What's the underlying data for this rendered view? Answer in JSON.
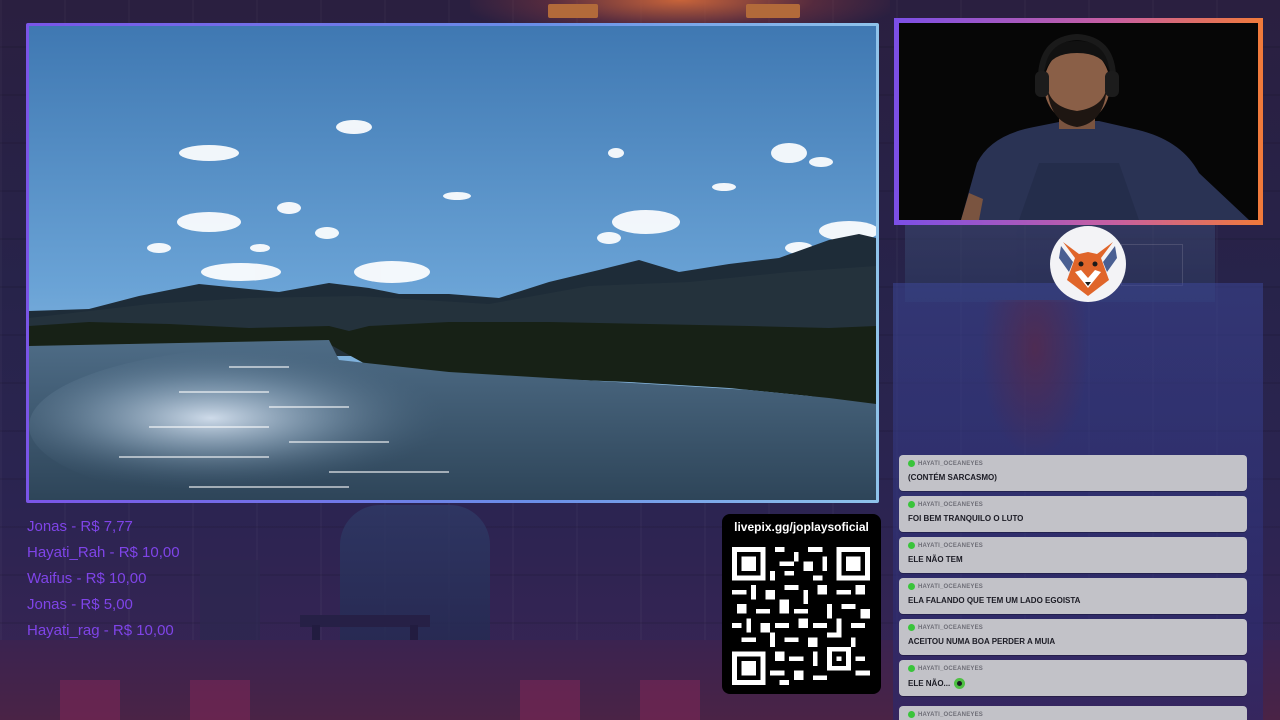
{
  "donations": [
    {
      "label": "Jonas - R$ 7,77"
    },
    {
      "label": "Hayati_Rah - R$ 10,00"
    },
    {
      "label": "Waifus - R$ 10,00"
    },
    {
      "label": "Jonas - R$ 5,00"
    },
    {
      "label": "Hayati_rag - R$ 10,00"
    }
  ],
  "qr": {
    "url": "livepix.gg/joplaysoficial"
  },
  "chat": [
    {
      "user": "HAYATI_OCEANEYES",
      "text": "(CONTÉM SARCASMO)"
    },
    {
      "user": "HAYATI_OCEANEYES",
      "text": "FOI BEM TRANQUILO O LUTO"
    },
    {
      "user": "HAYATI_OCEANEYES",
      "text": "ELE NÃO TEM"
    },
    {
      "user": "HAYATI_OCEANEYES",
      "text": "ELA FALANDO QUE TEM UM LADO EGOISTA"
    },
    {
      "user": "HAYATI_OCEANEYES",
      "text": "ACEITOU NUMA BOA PERDER A MUIA"
    },
    {
      "user": "HAYATI_OCEANEYES",
      "text": "ELE NÃO..."
    },
    {
      "user": "HAYATI_OCEANEYES",
      "text": ""
    }
  ],
  "colors": {
    "donation_text": "#7f44e8",
    "frame_gradient": [
      "#7a55e8",
      "#8fc3ea"
    ],
    "webcam_gradient": [
      "#7b4fe6",
      "#f07a3a"
    ],
    "chat_bubble": "#c2c2c8",
    "chat_status_dot": "#39c43b"
  },
  "icons": {
    "logo": "fox-logo-icon",
    "emote": "green-face-emote-icon"
  }
}
